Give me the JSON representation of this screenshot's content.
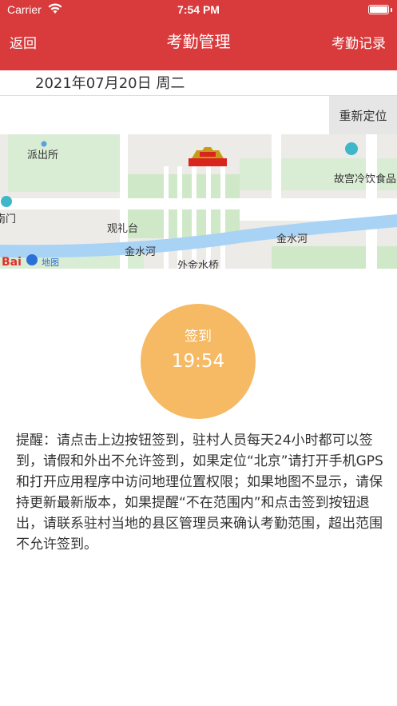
{
  "status_bar": {
    "carrier": "Carrier",
    "time": "7:54 PM"
  },
  "nav": {
    "back_label": "返回",
    "title": "考勤管理",
    "records_label": "考勤记录"
  },
  "date_row": {
    "date": "2021年07月20日 周二"
  },
  "location": {
    "relocate_label": "重新定位"
  },
  "map": {
    "labels": {
      "police": "派出所",
      "restaurant": "故宫冷饮食品",
      "gate": "南门",
      "platform": "观礼台",
      "river_left": "金水河",
      "river_right": "金水河",
      "bridge": "外金水桥",
      "logo_bai": "Bai",
      "logo_ditu": "地图"
    }
  },
  "checkin": {
    "label": "签到",
    "time": "19:54"
  },
  "notice": "提醒：请点击上边按钮签到，驻村人员每天24小时都可以签到，请假和外出不允许签到，如果定位“北京”请打开手机GPS和打开应用程序中访问地理位置权限；如果地图不显示，请保持更新最新版本，如果提醒“不在范围内”和点击签到按钮退出，请联系驻村当地的县区管理员来确认考勤范围，超出范围不允许签到。",
  "colors": {
    "nav_bg": "#d93a3c",
    "checkin_bg": "#f6b964",
    "river": "#a9d3f5",
    "green": "#cfe8c8"
  }
}
